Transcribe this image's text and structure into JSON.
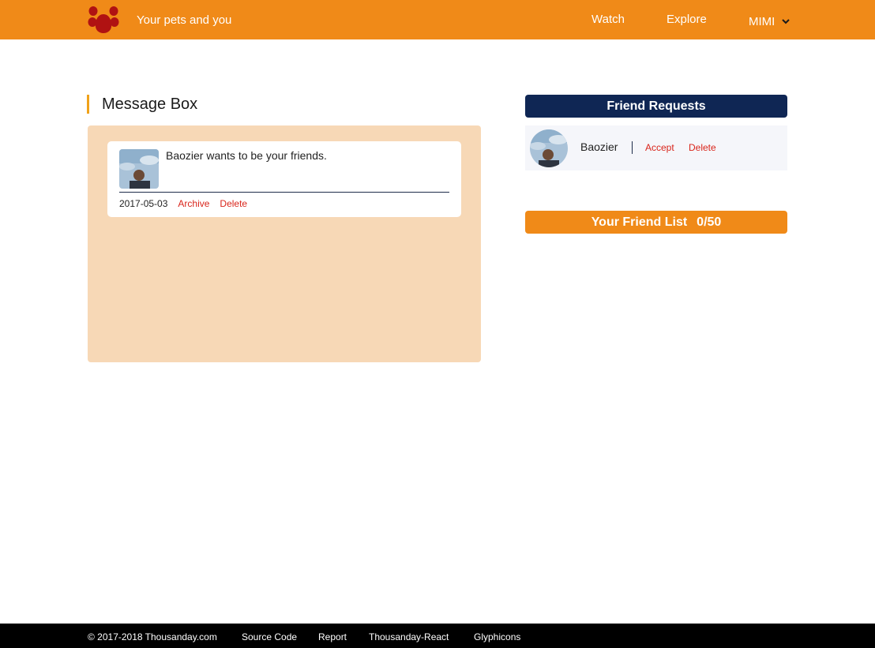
{
  "header": {
    "logo_icon": "paw-icon",
    "tagline": "Your pets and you",
    "nav": [
      {
        "label": "Watch"
      },
      {
        "label": "Explore"
      }
    ],
    "user": {
      "name": "MIMI",
      "menu_icon": "chevron-down-icon"
    }
  },
  "message_box": {
    "title": "Message Box",
    "messages": [
      {
        "text": "Baozier wants to be your friends.",
        "date": "2017-05-03",
        "archive_label": "Archive",
        "delete_label": "Delete"
      }
    ]
  },
  "friend_requests": {
    "title": "Friend Requests",
    "items": [
      {
        "name": "Baozier",
        "accept_label": "Accept",
        "delete_label": "Delete"
      }
    ]
  },
  "friend_list": {
    "title": "Your Friend List",
    "count": "0/50"
  },
  "footer": {
    "copyright": "© 2017-2018 Thousanday.com",
    "links": [
      {
        "label": "Source Code"
      },
      {
        "label": "Report"
      },
      {
        "label": "Thousanday-React"
      },
      {
        "label": "Glyphicons"
      }
    ]
  },
  "colors": {
    "brand_orange": "#f08a18",
    "navy": "#0f2654",
    "panel_peach": "#f7d8b6",
    "link_red": "#d9251b",
    "footer_black": "#000000"
  }
}
